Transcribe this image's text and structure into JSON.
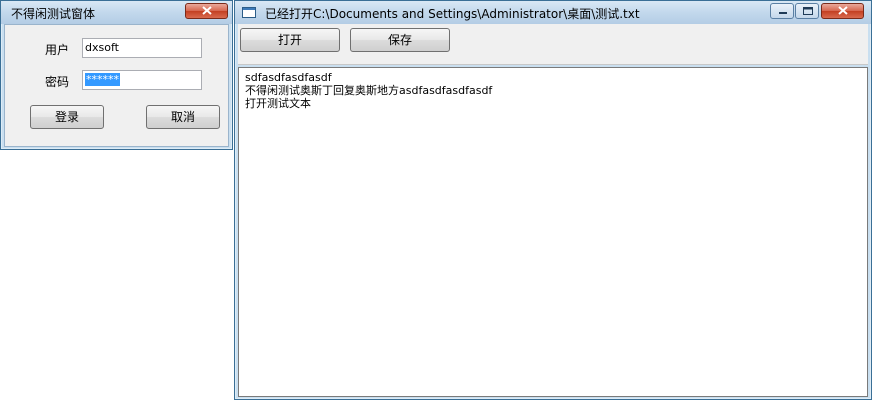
{
  "login_window": {
    "title": "不得闲测试窗体",
    "user_label": "用户",
    "user_value": "dxsoft",
    "password_label": "密码",
    "password_value": "******",
    "login_button": "登录",
    "cancel_button": "取消"
  },
  "editor_window": {
    "title": "已经打开C:\\Documents and Settings\\Administrator\\桌面\\测试.txt",
    "open_button": "打开",
    "save_button": "保存",
    "content": "sdfasdfasdfasdf\n不得闲测试奥斯丁回复奥斯地方asdfasdfasdfasdf\n打开测试文本"
  },
  "colors": {
    "frame": "#c9dff0",
    "selection": "#3399ff",
    "close_button": "#c33f22"
  },
  "icons": [
    "close-icon",
    "minimize-icon",
    "maximize-icon",
    "app-window-icon"
  ]
}
